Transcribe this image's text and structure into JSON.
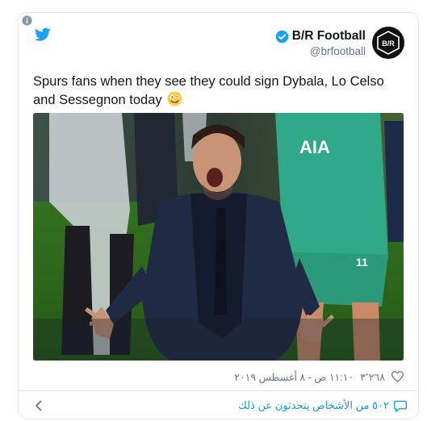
{
  "tweet": {
    "author": {
      "display_name": "B/R Football",
      "handle": "@brfootball",
      "verified": true,
      "avatar_text": "B/R"
    },
    "text": "Spurs fans when they see they could sign Dybala, Lo Celso and Sessegnon today",
    "emoji": "zany-face",
    "media": {
      "shirt_text": "AIA",
      "shirt_number": "11"
    },
    "meta": {
      "likes": "٣٬٢٦٨",
      "timestamp": "١١:١٠ ص - ٨ أغسطس ٢٠١٩"
    },
    "footer": {
      "people_talking": "٥٠٢ من الأشخاص يتحدثون عن ذلك"
    }
  },
  "colors": {
    "twitter_blue": "#1da1f2",
    "link_blue": "#1b95e0",
    "like_red": "#e0245e",
    "secondary_text": "#657786"
  }
}
